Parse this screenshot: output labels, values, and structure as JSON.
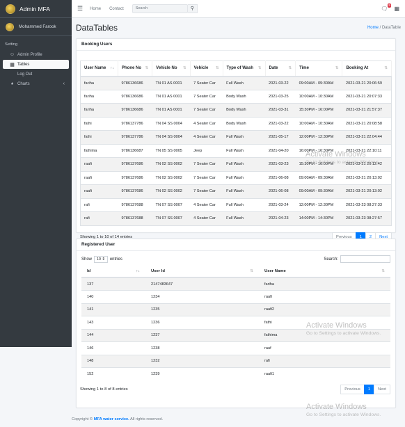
{
  "brand": {
    "name": "Admin MFA"
  },
  "user": {
    "name": "Mohammed Farook"
  },
  "sidebar": {
    "header": "Setting",
    "items": [
      {
        "label": "Admin Profile",
        "icon": "user-icon"
      },
      {
        "label": "Tables",
        "icon": "table-icon",
        "active": true
      },
      {
        "label": "Log Out",
        "icon": ""
      },
      {
        "label": "Charts",
        "icon": "chart-pie-icon",
        "has_children": true
      }
    ]
  },
  "topbar": {
    "home": "Home",
    "contact": "Contact",
    "search_placeholder": "Search",
    "notification_count": "9"
  },
  "page": {
    "title": "DataTables",
    "breadcrumb_home": "Home",
    "breadcrumb_sep": "/",
    "breadcrumb_current": "DataTable"
  },
  "booking": {
    "title": "Booking Users",
    "headers": [
      "User Name",
      "Phone No",
      "Vehicle No",
      "Vehicle",
      "Type of Wash",
      "Date",
      "Time",
      "Booking At"
    ],
    "rows": [
      [
        "fariha",
        "9786136686",
        "TN 01 AS 0001",
        "7 Seater Car",
        "Full Wash",
        "2021-03-22",
        "09:00AM - 09:30AM",
        "2021-03-21 20:06:59"
      ],
      [
        "fariha",
        "9786136686",
        "TN 01 AS 0001",
        "7 Seater Car",
        "Body Wash",
        "2021-03-25",
        "10:00AM - 10:30AM",
        "2021-03-21 20:07:33"
      ],
      [
        "fariha",
        "9786136686",
        "TN 01 AS 0001",
        "7 Seater Car",
        "Body Wash",
        "2021-03-31",
        "15:30PM - 16:00PM",
        "2021-03-21 21:57:37"
      ],
      [
        "fathi",
        "9786137786",
        "TN 04 SS 0004",
        "4 Seater Car",
        "Body Wash",
        "2021-03-22",
        "10:00AM - 10:30AM",
        "2021-03-21 20:08:58"
      ],
      [
        "fathi",
        "9786137786",
        "TN 04 SS 0004",
        "4 Seater Car",
        "Full Wash",
        "2021-05-17",
        "12:00PM - 12:30PM",
        "2021-03-21 22:04:44"
      ],
      [
        "fathima",
        "9786136687",
        "TN 05 SS 0005",
        "Jeep",
        "Full Wash",
        "2021-04-20",
        "16:00PM - 16:30PM",
        "2021-03-21 22:10:11"
      ],
      [
        "raafi",
        "9786137686",
        "TN 02 SS 0002",
        "7 Seater Car",
        "Full Wash",
        "2021-03-23",
        "15:30PM - 16:00PM",
        "2021-03-21 20:12:42"
      ],
      [
        "raafi",
        "9786137686",
        "TN 02 SS 0002",
        "7 Seater Car",
        "Full Wash",
        "2021-06-08",
        "09:00AM - 09:30AM",
        "2021-03-21 20:13:02"
      ],
      [
        "raafi",
        "9786137686",
        "TN 02 SS 0002",
        "7 Seater Car",
        "Full Wash",
        "2021-06-08",
        "09:00AM - 09:30AM",
        "2021-03-21 20:13:02"
      ],
      [
        "rafi",
        "9786137688",
        "TN 07 SS 0007",
        "4 Seater Car",
        "Full Wash",
        "2021-03-24",
        "12:00PM - 12:30PM",
        "2021-03-23 08:27:33"
      ],
      [
        "rafi",
        "9786137688",
        "TN 07 SS 0007",
        "4 Seater Car",
        "Full Wash",
        "2021-04-23",
        "14:00PM - 14:30PM",
        "2021-03-23 08:27:57"
      ]
    ],
    "info": "Showing 1 to 10 of 14 entries",
    "pagination": {
      "previous": "Previous",
      "pages": [
        "1",
        "2"
      ],
      "next": "Next"
    }
  },
  "registered": {
    "title": "Registered User",
    "show_label": "Show",
    "show_value": "10",
    "entries_label": "entries",
    "search_label": "Search:",
    "headers": [
      "Id",
      "User Id",
      "User Name"
    ],
    "rows": [
      [
        "137",
        "2147483647",
        "fariha"
      ],
      [
        "140",
        "1234",
        "raafi"
      ],
      [
        "141",
        "1235",
        "raafi2"
      ],
      [
        "143",
        "1236",
        "fathi"
      ],
      [
        "144",
        "1237",
        "fathima"
      ],
      [
        "146",
        "1238",
        "rauf"
      ],
      [
        "148",
        "1232",
        "rafi"
      ],
      [
        "152",
        "1239",
        "raafi1"
      ]
    ],
    "info": "Showing 1 to 8 of 8 entries",
    "pagination": {
      "previous": "Previous",
      "page": "1",
      "next": "Next"
    }
  },
  "watermark": {
    "line1": "Activate Windows",
    "line2": "Go to Settings to activate Windows."
  },
  "footer": {
    "prefix": "Copyright ©",
    "brand": "MFA water service.",
    "suffix": "All rights reserved."
  }
}
